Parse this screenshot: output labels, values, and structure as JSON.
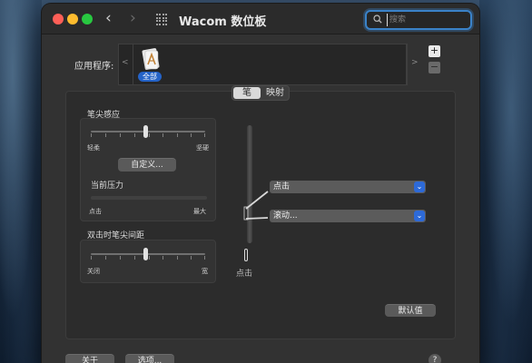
{
  "window": {
    "title": "Wacom 数位板",
    "search": {
      "placeholder": "搜索",
      "value": ""
    }
  },
  "toolbar": {
    "back_glyph": "‹",
    "forward_glyph": "›"
  },
  "applications": {
    "label": "应用程序:",
    "left_arrow": "<",
    "right_arrow": ">",
    "selected_badge": "全部",
    "add_glyph": "+",
    "remove_glyph": "−"
  },
  "tabs": [
    {
      "label": "笔",
      "active": true
    },
    {
      "label": "映射",
      "active": false
    }
  ],
  "tip_feel": {
    "title": "笔尖感应",
    "soft_label": "轻柔",
    "firm_label": "坚硬",
    "value_fraction": 0.48,
    "customize_button": "自定义...",
    "current_pressure": {
      "label": "当前压力",
      "click_label": "点击",
      "max_label": "最大",
      "value_fraction": 0.0
    }
  },
  "double_click": {
    "title": "双击时笔尖间距",
    "off_label": "关闭",
    "wide_label": "宽",
    "value_fraction": 0.48
  },
  "pen": {
    "tip_label": "点击",
    "upper_button": {
      "value": "点击"
    },
    "lower_button": {
      "value": "滚动..."
    }
  },
  "footer": {
    "default_button": "默认值",
    "about_button": "关于",
    "options_button": "选项...",
    "help_glyph": "?"
  },
  "colors": {
    "accent": "#2d6ad8",
    "window_bg": "#323232",
    "close": "#fe5f57",
    "minimize": "#febc2e",
    "maximize": "#28c840"
  }
}
